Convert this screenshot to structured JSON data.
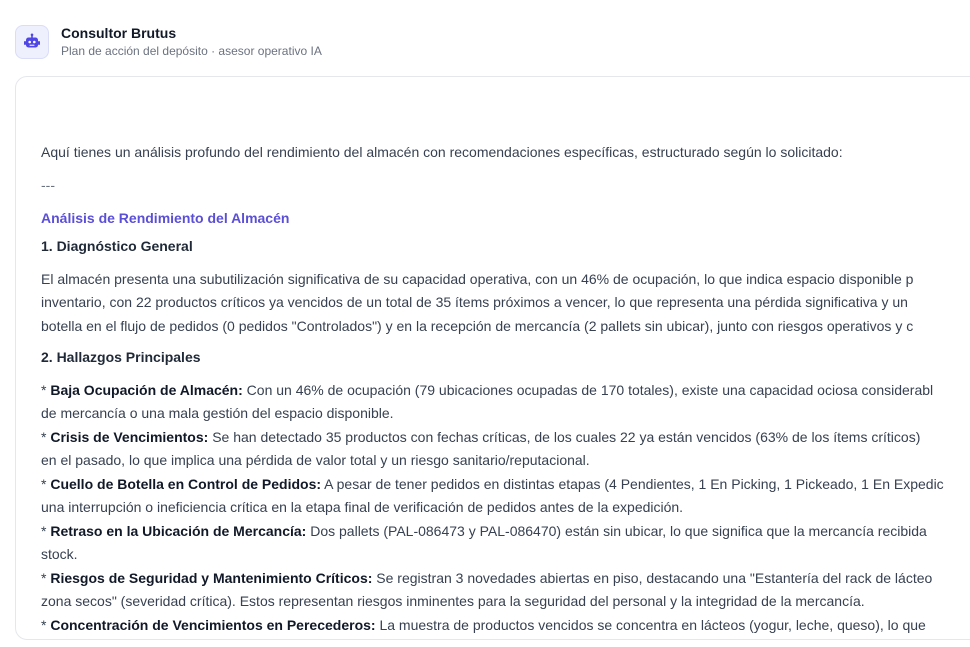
{
  "header": {
    "title": "Consultor Brutus",
    "subtitle": "Plan de acción del depósito · asesor operativo IA",
    "avatar_icon": "robot-icon",
    "accent_color": "#5b4fd6"
  },
  "message": {
    "intro": "Aquí tienes un análisis profundo del rendimiento del almacén con recomendaciones específicas, estructurado según lo solicitado:",
    "separator": "---",
    "section_heading": "Análisis de Rendimiento del Almacén",
    "diagnostico": {
      "heading": "1. Diagnóstico General",
      "lines": [
        "El almacén presenta una subutilización significativa de su capacidad operativa, con un 46% de ocupación, lo que indica espacio disponible p",
        "inventario, con 22 productos críticos ya vencidos de un total de 35 ítems próximos a vencer, lo que representa una pérdida significativa y un",
        "botella en el flujo de pedidos (0 pedidos \"Controlados\") y en la recepción de mercancía (2 pallets sin ubicar), junto con riesgos operativos y c"
      ]
    },
    "hallazgos": {
      "heading": "2. Hallazgos Principales",
      "items": [
        {
          "label": "Baja Ocupación de Almacén:",
          "text": "Con un 46% de ocupación (79 ubicaciones ocupadas de 170 totales), existe una capacidad ociosa considerabl",
          "cont": "de mercancía o una mala gestión del espacio disponible."
        },
        {
          "label": "Crisis de Vencimientos:",
          "text": "Se han detectado 35 productos con fechas críticas, de los cuales 22 ya están vencidos (63% de los ítems críticos)",
          "cont": "en el pasado, lo que implica una pérdida de valor total y un riesgo sanitario/reputacional."
        },
        {
          "label": "Cuello de Botella en Control de Pedidos:",
          "text": "A pesar de tener pedidos en distintas etapas (4 Pendientes, 1 En Picking, 1 Pickeado, 1 En Expedic",
          "cont": "una interrupción o ineficiencia crítica en la etapa final de verificación de pedidos antes de la expedición."
        },
        {
          "label": "Retraso en la Ubicación de Mercancía:",
          "text": "Dos pallets (PAL-086473 y PAL-086470) están sin ubicar, lo que significa que la mercancía recibida",
          "cont": "stock."
        },
        {
          "label": "Riesgos de Seguridad y Mantenimiento Críticos:",
          "text": "Se registran 3 novedades abiertas en piso, destacando una \"Estantería del rack de lácteo",
          "cont": "zona secos\" (severidad crítica). Estos representan riesgos inminentes para la seguridad del personal y la integridad de la mercancía."
        },
        {
          "label": "Concentración de Vencimientos en Perecederos:",
          "text": "La muestra de productos vencidos se concentra en lácteos (yogur, leche, queso), lo que",
          "cont": ""
        }
      ]
    }
  }
}
